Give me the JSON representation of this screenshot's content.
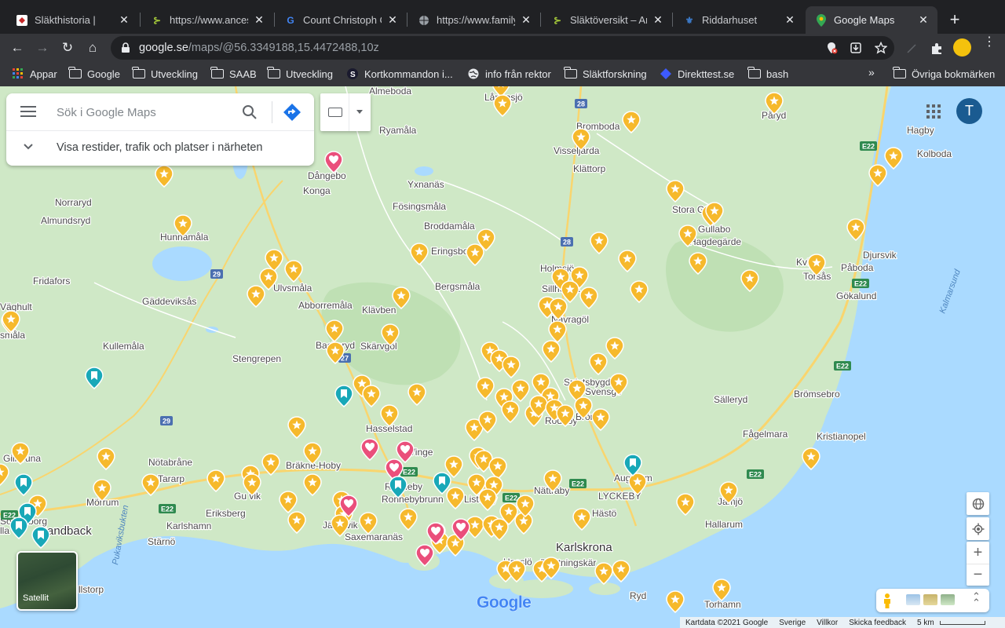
{
  "browser": {
    "tabs": [
      {
        "title": "Släkthistoria |",
        "favicon_color": "#c62828",
        "active": false
      },
      {
        "title": "https://www.ances",
        "favicon_color": "#a5c93a",
        "active": false
      },
      {
        "title": "Count Christoph C",
        "favicon_color": "#4285f4",
        "active": false
      },
      {
        "title": "https://www.family",
        "favicon_color": "#9aa0a6",
        "active": false
      },
      {
        "title": "Släktöversikt – An",
        "favicon_color": "#a5c93a",
        "active": false
      },
      {
        "title": "Riddarhuset",
        "favicon_color": "#3b78c4",
        "active": false
      },
      {
        "title": "Google Maps",
        "favicon_color": "#34a853",
        "active": true
      }
    ],
    "url_host": "google.se",
    "url_path": "/maps/@56.3349188,15.4472488,10z",
    "bookmarks": [
      {
        "label": "Appar",
        "icon": "apps-grid-icon"
      },
      {
        "label": "Google",
        "icon": "folder-icon"
      },
      {
        "label": "Utveckling",
        "icon": "folder-icon"
      },
      {
        "label": "SAAB",
        "icon": "folder-icon"
      },
      {
        "label": "Utveckling",
        "icon": "folder-icon"
      },
      {
        "label": "Kortkommandon i...",
        "icon": "s-logo-icon"
      },
      {
        "label": "info från rektor",
        "icon": "globe-icon"
      },
      {
        "label": "Släktforskning",
        "icon": "folder-icon"
      },
      {
        "label": "Direkttest.se",
        "icon": "diamond-icon"
      },
      {
        "label": "bash",
        "icon": "folder-icon"
      }
    ],
    "bookmarks_overflow": "»",
    "other_bookmarks": "Övriga bokmärken"
  },
  "maps": {
    "search_placeholder": "Sök i Google Maps",
    "nearby_label": "Visa restider, trafik och platser i närheten",
    "account_initial": "T",
    "satellite_label": "Satellit",
    "logo": "Google",
    "attribution": [
      "Kartdata ©2021 Google",
      "Sverige",
      "Villkor",
      "Skicka feedback",
      "5 km"
    ]
  },
  "map_labels": [
    {
      "text": "Almeboda"
    },
    {
      "text": "Långasjö"
    },
    {
      "text": "Bromboda"
    },
    {
      "text": "Visseljärda"
    },
    {
      "text": "Klättorp"
    },
    {
      "text": "Påryd"
    },
    {
      "text": "Hagby"
    },
    {
      "text": "Kolboda"
    },
    {
      "text": "Dångebo"
    },
    {
      "text": "Konga"
    },
    {
      "text": "Ryamåla"
    },
    {
      "text": "Yxnanäs"
    },
    {
      "text": "Norraryd"
    },
    {
      "text": "Almundsryd"
    },
    {
      "text": "Fösingsmåla"
    },
    {
      "text": "Broddamåla"
    },
    {
      "text": "Eringsboda"
    },
    {
      "text": "Hunnamåla"
    },
    {
      "text": "Stora Gulbo"
    },
    {
      "text": "Gullabo"
    },
    {
      "text": "Hagdegärde"
    },
    {
      "text": "Djursvik"
    },
    {
      "text": "Kvi"
    },
    {
      "text": "Torsås"
    },
    {
      "text": "Påboda"
    },
    {
      "text": "Gökalund"
    },
    {
      "text": "Fridafors"
    },
    {
      "text": "Ulvsmåla"
    },
    {
      "text": "Bergsmåla"
    },
    {
      "text": "Holmsjö"
    },
    {
      "text": "Sillhövda"
    },
    {
      "text": "Gäddeviksås"
    },
    {
      "text": "Abborremåla"
    },
    {
      "text": "Klävben"
    },
    {
      "text": "Nävragöl"
    },
    {
      "text": "Väghult"
    },
    {
      "text": "småla"
    },
    {
      "text": "Kullemåla"
    },
    {
      "text": "Backaryd"
    },
    {
      "text": "Skärvgöl"
    },
    {
      "text": "Stengrepen"
    },
    {
      "text": "Spjutsbygd"
    },
    {
      "text": "Svensgö"
    },
    {
      "text": "Rödeby"
    },
    {
      "text": "Bröms"
    },
    {
      "text": "Sälleryd"
    },
    {
      "text": "Brömsebro"
    },
    {
      "text": "Hasselstad"
    },
    {
      "text": "Fågelmara"
    },
    {
      "text": "Kristianopel"
    },
    {
      "text": "Gillaruna"
    },
    {
      "text": "Nötabråne"
    },
    {
      "text": "Bräkne-Hoby"
    },
    {
      "text": "Tararp"
    },
    {
      "text": "Ronneby"
    },
    {
      "text": "Ronnebybrunn"
    },
    {
      "text": "Listerby"
    },
    {
      "text": "Nättraby"
    },
    {
      "text": "Augerum"
    },
    {
      "text": "LYCKEBY"
    },
    {
      "text": "Mörrum"
    },
    {
      "text": "Gu vik"
    },
    {
      "text": "Jämjö"
    },
    {
      "text": "Eriksberg"
    },
    {
      "text": "Hästö"
    },
    {
      "text": "Karlshamn"
    },
    {
      "text": "Hallarum"
    },
    {
      "text": "Sandback"
    },
    {
      "text": "Sölvesborg"
    },
    {
      "text": "Järnavik"
    },
    {
      "text": "Saxemaranäs"
    },
    {
      "text": "Karlskrona"
    },
    {
      "text": "Stärnö"
    },
    {
      "text": "Hasslö"
    },
    {
      "text": "Drottningskär"
    },
    {
      "text": "Ryd"
    },
    {
      "text": "Torhamn"
    },
    {
      "text": "llstorp"
    },
    {
      "text": "Pukaviksbukten"
    },
    {
      "text": "Kalmarsund"
    },
    {
      "text": "lla"
    },
    {
      "text": "Vinge"
    }
  ],
  "road_shields": [
    {
      "label": "28"
    },
    {
      "label": "28"
    },
    {
      "label": "29"
    },
    {
      "label": "29"
    },
    {
      "label": "27"
    },
    {
      "label": "E22"
    },
    {
      "label": "E22"
    },
    {
      "label": "E22"
    },
    {
      "label": "E22"
    },
    {
      "label": "E22"
    },
    {
      "label": "E22"
    },
    {
      "label": "E22"
    },
    {
      "label": "E22"
    },
    {
      "label": "E22"
    }
  ],
  "colors": {
    "land": "#cde8c4",
    "water": "#aadaff",
    "star_pin": "#f6b92c",
    "heart_pin": "#ea4f7b",
    "teal_pin": "#18a8b8",
    "road": "#f9d56e"
  },
  "pin_counts": {
    "starred": 118,
    "favorite": 8,
    "want_to_go": 9
  }
}
